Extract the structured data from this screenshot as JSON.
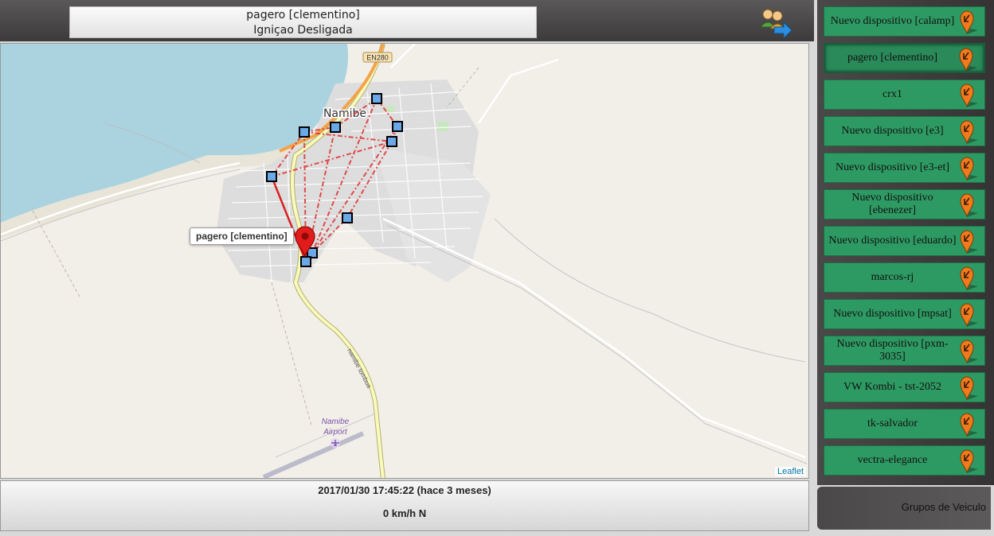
{
  "header": {
    "device_title": "pagero [clementino]",
    "status": "Igniçao Desligada",
    "group_icon": "users-arrow-icon"
  },
  "map": {
    "city_label": "Namibe",
    "road_label": "EN280",
    "route_label": "namibe tombua",
    "airport_label_1": "Namibe",
    "airport_label_2": "Airport",
    "tooltip": "pagero [clementino]",
    "attribution": "Leaflet",
    "colors": {
      "water": "#aad3df",
      "land": "#f2efe9",
      "route_line": "#e03030",
      "marker": "#e21b1b"
    }
  },
  "footer": {
    "timestamp": "2017/01/30 17:45:22 (hace 3 meses)",
    "speed": "0 km/h N"
  },
  "sidebar": {
    "devices": [
      {
        "label": "Nuevo dispositivo [calamp]",
        "selected": false
      },
      {
        "label": "pagero [clementino]",
        "selected": true
      },
      {
        "label": "crx1",
        "selected": false
      },
      {
        "label": "Nuevo dispositivo [e3]",
        "selected": false
      },
      {
        "label": "Nuevo dispositivo [e3-et]",
        "selected": false
      },
      {
        "label": "Nuevo dispositivo [ebenezer]",
        "selected": false
      },
      {
        "label": "Nuevo dispositivo [eduardo]",
        "selected": false
      },
      {
        "label": "marcos-rj",
        "selected": false
      },
      {
        "label": "Nuevo dispositivo [mpsat]",
        "selected": false
      },
      {
        "label": "Nuevo dispositivo [pxm-3035]",
        "selected": false
      },
      {
        "label": "VW Kombi - tst-2052",
        "selected": false
      },
      {
        "label": "tk-salvador",
        "selected": false
      },
      {
        "label": "vectra-elegance",
        "selected": false
      }
    ],
    "pin_icon": "map-pin-icon",
    "groups_label": "Grupos de Veiculo"
  }
}
